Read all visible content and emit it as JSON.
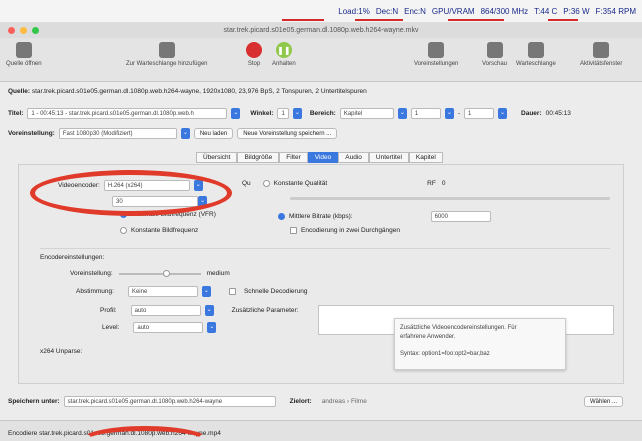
{
  "menubar": {
    "load": "Load:1%",
    "dec": "Dec:N",
    "enc": "Enc:N",
    "gpu": "GPU/VRAM",
    "mhz": "864/300 MHz",
    "temp": "T:44 C",
    "power": "P:36 W",
    "fan": "F:354 RPM"
  },
  "window": {
    "title": "star.trek.picard.s01e05.german.dl.1080p.web.h264-wayne.mkv"
  },
  "toolbar": {
    "source": "Quelle öffnen",
    "add_queue": "Zur Warteschlange hinzufügen",
    "stop": "Stop",
    "pause": "Anhalten",
    "presets": "Voreinstellungen",
    "preview": "Vorschau",
    "queue": "Warteschlange",
    "activity": "Aktivitätsfenster"
  },
  "source": {
    "label": "Quelle:",
    "value": "star.trek.picard.s01e05.german.dl.1080p.web.h264-wayne, 1920x1080, 23,976 BpS, 2 Tonspuren, 2 Untertitelspuren"
  },
  "title_row": {
    "title_label": "Titel:",
    "title_value": "1 - 00:45:13 - star.trek.picard.s01e05.german.dl.1080p.web.h",
    "angle_label": "Winkel:",
    "angle_value": "1",
    "range_label": "Bereich:",
    "range_type": "Kapitel",
    "range_from": "1",
    "range_sep": "-",
    "range_to": "1",
    "duration_label": "Dauer:",
    "duration_value": "00:45:13"
  },
  "preset_row": {
    "label": "Voreinstellung:",
    "value": "Fast 1080p30 (Modifiziert)",
    "reload": "Neu laden",
    "save_new": "Neue Voreinstellung speichern ..."
  },
  "tabs": [
    "Übersicht",
    "Bildgröße",
    "Filter",
    "Video",
    "Audio",
    "Untertitel",
    "Kapitel"
  ],
  "video": {
    "encoder_label": "Videoencoder:",
    "encoder_value": "H.264 (x264)",
    "quality_label": "Qu",
    "const_quality": "Konstante Qualität",
    "rf_label": "RF",
    "rf_value": "0",
    "fps_value": "30",
    "vfr": "Maximale Bildfrequenz (VFR)",
    "cfr": "Konstante Bildfrequenz",
    "avg_bitrate": "Mittlere Bitrate (kbps):",
    "bitrate_value": "6000",
    "twopass": "Encodierung in zwei Durchgängen"
  },
  "encoder_settings": {
    "heading": "Encodereinstellungen:",
    "preset_label": "Voreinstellung:",
    "preset_value": "medium",
    "tune_label": "Abstimmung:",
    "tune_value": "Keine",
    "fast_decode": "Schnelle Decodierung",
    "profile_label": "Profil:",
    "profile_value": "auto",
    "extra_label": "Zusätzliche Parameter:",
    "level_label": "Level:",
    "level_value": "auto",
    "unparse_label": "x264 Unparse:"
  },
  "tooltip": {
    "line1": "Zusätzliche Videoencodereinstellungen. Für",
    "line2": "erfahrene Anwender.",
    "line3": "Syntax: option1=foo:opt2=bar,baz"
  },
  "save": {
    "label": "Speichern unter:",
    "value": "star.trek.picard.s01e05.german.dl.1080p.web.h264-wayne",
    "target_label": "Zielort:",
    "target_value": "andreas › Filme",
    "choose": "Wählen ..."
  },
  "status": {
    "text": "Encodiere star.trek.picard.s01e05.german.dl.1080p.web.h264-wayne.mp4"
  },
  "colors": {
    "accent": "#3a78e0",
    "annotation": "#e03a2a"
  }
}
